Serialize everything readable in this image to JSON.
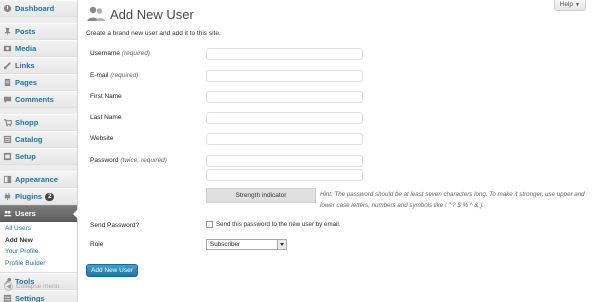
{
  "sidebar": {
    "items": [
      {
        "label": "Dashboard",
        "icon": "dashboard-icon"
      },
      {
        "label": "Posts",
        "icon": "pushpin-icon"
      },
      {
        "label": "Media",
        "icon": "media-icon"
      },
      {
        "label": "Links",
        "icon": "link-icon"
      },
      {
        "label": "Pages",
        "icon": "page-icon"
      },
      {
        "label": "Comments",
        "icon": "comment-icon"
      },
      {
        "label": "Shopp",
        "icon": "shopp-icon"
      },
      {
        "label": "Catalog",
        "icon": "catalog-icon"
      },
      {
        "label": "Setup",
        "icon": "setup-icon"
      },
      {
        "label": "Appearance",
        "icon": "appearance-icon"
      },
      {
        "label": "Plugins",
        "icon": "plugin-icon",
        "badge": "2"
      },
      {
        "label": "Users",
        "icon": "users-icon"
      },
      {
        "label": "Tools",
        "icon": "tools-icon"
      },
      {
        "label": "Settings",
        "icon": "settings-icon"
      }
    ],
    "users_submenu": [
      "All Users",
      "Add New",
      "Your Profile",
      "Profile Builder"
    ],
    "collapse_label": "Collapse menu"
  },
  "help": {
    "label": "Help"
  },
  "page": {
    "title": "Add New User",
    "intro": "Create a brand new user and add it to this site."
  },
  "form": {
    "username_label": "Username",
    "username_req": "(required)",
    "email_label": "E-mail",
    "email_req": "(required)",
    "first_name_label": "First Name",
    "last_name_label": "Last Name",
    "website_label": "Website",
    "password_label": "Password",
    "password_req": "(twice, required)",
    "strength_label": "Strength indicator",
    "hint": "Hint: The password should be at least seven characters long. To make it stronger, use upper and lower case letters, numbers and symbols like ! \" ? $ % ^ & ).",
    "send_password_label": "Send Password?",
    "send_password_text": "Send this password to the new user by email.",
    "role_label": "Role",
    "role_value": "Subscriber",
    "submit_label": "Add New User"
  },
  "colors": {
    "link": "#21759b",
    "active_menu": "#6d6d6d",
    "button": "#21759b"
  }
}
